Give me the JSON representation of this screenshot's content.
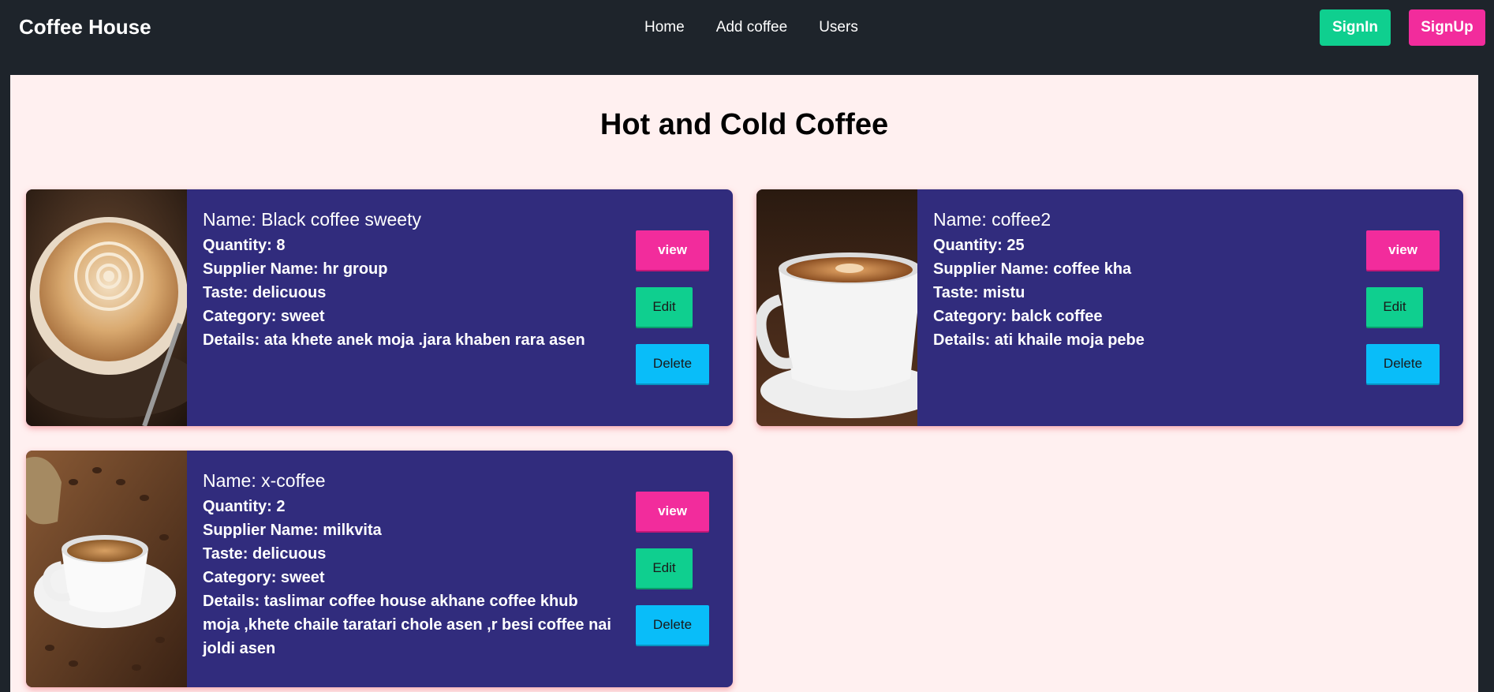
{
  "nav": {
    "brand": "Coffee House",
    "links": [
      "Home",
      "Add coffee",
      "Users"
    ],
    "signin_label": "SignIn",
    "signup_label": "SignUp"
  },
  "page": {
    "title": "Hot and Cold Coffee"
  },
  "cards": [
    {
      "name": "Name: Black coffee sweety",
      "quantity": "Quantity: 8",
      "supplier": "Supplier Name: hr group",
      "taste": "Taste: delicuous",
      "category": "Category: sweet",
      "details": "Details: ata khete anek moja .jara khaben rara asen",
      "view_label": "view",
      "edit_label": "Edit",
      "delete_label": "Delete"
    },
    {
      "name": "Name: coffee2",
      "quantity": "Quantity: 25",
      "supplier": "Supplier Name: coffee kha",
      "taste": "Taste: mistu",
      "category": "Category: balck coffee",
      "details": "Details: ati khaile moja pebe",
      "view_label": "view",
      "edit_label": "Edit",
      "delete_label": "Delete"
    },
    {
      "name": "Name: x-coffee",
      "quantity": "Quantity: 2",
      "supplier": "Supplier Name: milkvita",
      "taste": "Taste: delicuous",
      "category": "Category: sweet",
      "details": "Details: taslimar coffee house akhane coffee khub moja ,khete chaile taratari chole asen ,r besi coffee nai joldi asen",
      "view_label": "view",
      "edit_label": "Edit",
      "delete_label": "Delete"
    }
  ],
  "colors": {
    "navbar": "#1e242b",
    "page_bg": "#fff0f0",
    "card_bg": "#312c7d",
    "pink": "#f22c9c",
    "green": "#0fcf8f",
    "blue": "#09bdf9"
  }
}
